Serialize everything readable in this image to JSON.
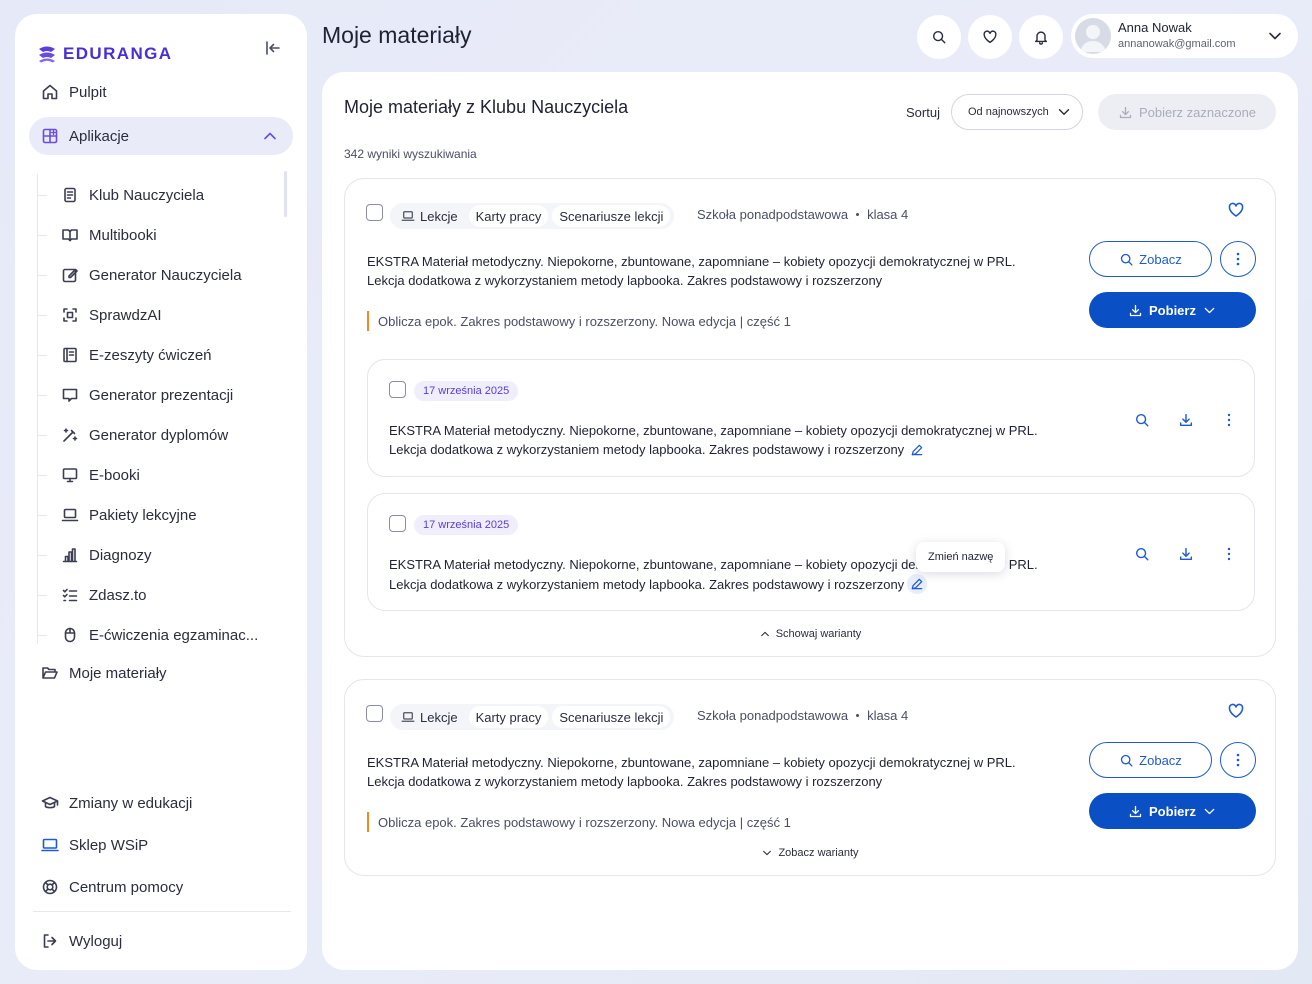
{
  "brand": {
    "logo_text": "EDURANGA",
    "accent": "#4a2ed6"
  },
  "colors": {
    "primary": "#0b4fc4",
    "series_marker": "#f08a1e",
    "date_badge": "#5a3dd6"
  },
  "sidebar": {
    "items_top": [
      {
        "label": "Pulpit",
        "icon": "home-icon"
      },
      {
        "label": "Aplikacje",
        "icon": "apps-icon",
        "expanded": true
      }
    ],
    "apps": [
      {
        "label": "Klub Nauczyciela",
        "icon": "club-icon"
      },
      {
        "label": "Multibooki",
        "icon": "book-open-icon"
      },
      {
        "label": "Generator Nauczyciela",
        "icon": "edit-icon"
      },
      {
        "label": "SprawdzAI",
        "icon": "scan-icon"
      },
      {
        "label": "E-zeszyty ćwiczeń",
        "icon": "notebook-icon"
      },
      {
        "label": "Generator prezentacji",
        "icon": "presentation-icon"
      },
      {
        "label": "Generator dyplomów",
        "icon": "magic-wand-icon"
      },
      {
        "label": "E-booki",
        "icon": "monitor-icon"
      },
      {
        "label": "Pakiety lekcyjne",
        "icon": "laptop-icon"
      },
      {
        "label": "Diagnozy",
        "icon": "bar-chart-icon"
      },
      {
        "label": "Zdasz.to",
        "icon": "checklist-icon"
      },
      {
        "label": "E-ćwiczenia egzaminac...",
        "icon": "mouse-icon"
      }
    ],
    "my_materials": "Moje materiały",
    "items_bottom": [
      {
        "label": "Zmiany w edukacji",
        "icon": "graduation-cap-icon"
      },
      {
        "label": "Sklep WSiP",
        "icon": "laptop-blue-icon"
      },
      {
        "label": "Centrum pomocy",
        "icon": "lifebuoy-icon"
      }
    ],
    "logout": "Wyloguj"
  },
  "header": {
    "title": "Moje materiały",
    "user": {
      "name": "Anna Nowak",
      "email": "annanowak@gmail.com"
    }
  },
  "main": {
    "title": "Moje materiały z Klubu Nauczyciela",
    "results": "342 wyniki wyszukiwania",
    "sort_label": "Sortuj",
    "sort_value": "Od najnowszych",
    "download_selected": "Pobierz zaznaczone"
  },
  "cards": [
    {
      "tags": [
        "Lekcje",
        "Karty pracy",
        "Scenariusze lekcji"
      ],
      "school": "Szkoła ponadpodstawowa",
      "grade": "klasa 4",
      "desc_line1": "EKSTRA Materiał metodyczny. Niepokorne, zbuntowane, zapomniane – kobiety opozycji demokratycznej w PRL.",
      "desc_line2": "Lekcja dodatkowa z wykorzystaniem metody lapbooka. Zakres podstawowy i rozszerzony",
      "series": "Oblicza epok. Zakres podstawowy i rozszerzony. Nowa edycja | część 1",
      "view_label": "Zobacz",
      "download_label": "Pobierz",
      "variants": [
        {
          "date": "17 września 2025",
          "line1": "EKSTRA Materiał metodyczny. Niepokorne, zbuntowane, zapomniane – kobiety opozycji demokratycznej w PRL.",
          "line2": "Lekcja dodatkowa z wykorzystaniem metody lapbooka. Zakres podstawowy i rozszerzony"
        },
        {
          "date": "17 września 2025",
          "line1": "EKSTRA Materiał metodyczny. Niepokorne, zbuntowane, zapomniane – kobiety opozycji demokratycznej w PRL.",
          "line2": "Lekcja dodatkowa z wykorzystaniem metody lapbooka. Zakres podstawowy i rozszerzony",
          "tooltip": "Zmień nazwę"
        }
      ],
      "toggle": "Schowaj warianty"
    },
    {
      "tags": [
        "Lekcje",
        "Karty pracy",
        "Scenariusze lekcji"
      ],
      "school": "Szkoła ponadpodstawowa",
      "grade": "klasa 4",
      "desc_line1": "EKSTRA Materiał metodyczny. Niepokorne, zbuntowane, zapomniane – kobiety opozycji demokratycznej w PRL.",
      "desc_line2": "Lekcja dodatkowa z wykorzystaniem metody lapbooka. Zakres podstawowy i rozszerzony",
      "series": "Oblicza epok. Zakres podstawowy i rozszerzony. Nowa edycja | część 1",
      "view_label": "Zobacz",
      "download_label": "Pobierz",
      "toggle": "Zobacz warianty"
    }
  ]
}
